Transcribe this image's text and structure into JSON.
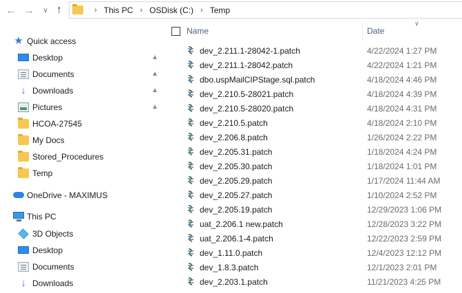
{
  "breadcrumb": [
    "This PC",
    "OSDisk (C:)",
    "Temp"
  ],
  "columns": {
    "name": "Name",
    "date": "Date"
  },
  "sidebar": {
    "quick_access": "Quick access",
    "quick_items": [
      {
        "label": "Desktop",
        "icon": "desktop-icon",
        "pinned": true
      },
      {
        "label": "Documents",
        "icon": "documents-icon",
        "pinned": true
      },
      {
        "label": "Downloads",
        "icon": "downloads-icon",
        "pinned": true
      },
      {
        "label": "Pictures",
        "icon": "pictures-icon",
        "pinned": true
      },
      {
        "label": "HCOA-27545",
        "icon": "folder-icon",
        "pinned": false
      },
      {
        "label": "My Docs",
        "icon": "folder-icon",
        "pinned": false
      },
      {
        "label": "Stored_Procedures",
        "icon": "folder-icon",
        "pinned": false
      },
      {
        "label": "Temp",
        "icon": "folder-icon",
        "pinned": false
      }
    ],
    "onedrive": "OneDrive - MAXIMUS",
    "this_pc": "This PC",
    "pc_items": [
      {
        "label": "3D Objects",
        "icon": "3d-objects-icon"
      },
      {
        "label": "Desktop",
        "icon": "desktop-icon"
      },
      {
        "label": "Documents",
        "icon": "documents-icon"
      },
      {
        "label": "Downloads",
        "icon": "downloads-icon"
      }
    ]
  },
  "files": [
    {
      "name": "dev_2.211.1-28042-1.patch",
      "date": "4/22/2024 1:27 PM"
    },
    {
      "name": "dev_2.211.1-28042.patch",
      "date": "4/22/2024 1:21 PM"
    },
    {
      "name": "dbo.uspMailCIPStage.sql.patch",
      "date": "4/18/2024 4:46 PM"
    },
    {
      "name": "dev_2.210.5-28021.patch",
      "date": "4/18/2024 4:39 PM"
    },
    {
      "name": "dev_2.210.5-28020.patch",
      "date": "4/18/2024 4:31 PM"
    },
    {
      "name": "dev_2.210.5.patch",
      "date": "4/18/2024 2:10 PM"
    },
    {
      "name": "dev_2.206.8.patch",
      "date": "1/26/2024 2:22 PM"
    },
    {
      "name": "dev_2.205.31.patch",
      "date": "1/18/2024 4:24 PM"
    },
    {
      "name": "dev_2.205.30.patch",
      "date": "1/18/2024 1:01 PM"
    },
    {
      "name": "dev_2.205.29.patch",
      "date": "1/17/2024 11:44 AM"
    },
    {
      "name": "dev_2.205.27.patch",
      "date": "1/10/2024 2:52 PM"
    },
    {
      "name": "dev_2.205.19.patch",
      "date": "12/29/2023 1:06 PM"
    },
    {
      "name": "uat_2.206.1 new.patch",
      "date": "12/28/2023 3:22 PM"
    },
    {
      "name": "uat_2.206.1-4.patch",
      "date": "12/22/2023 2:59 PM"
    },
    {
      "name": "dev_1.11.0.patch",
      "date": "12/4/2023 12:12 PM"
    },
    {
      "name": "dev_1.8.3.patch",
      "date": "12/1/2023 2:01 PM"
    },
    {
      "name": "dev_2.203.1.patch",
      "date": "11/21/2023 4:25 PM"
    }
  ]
}
